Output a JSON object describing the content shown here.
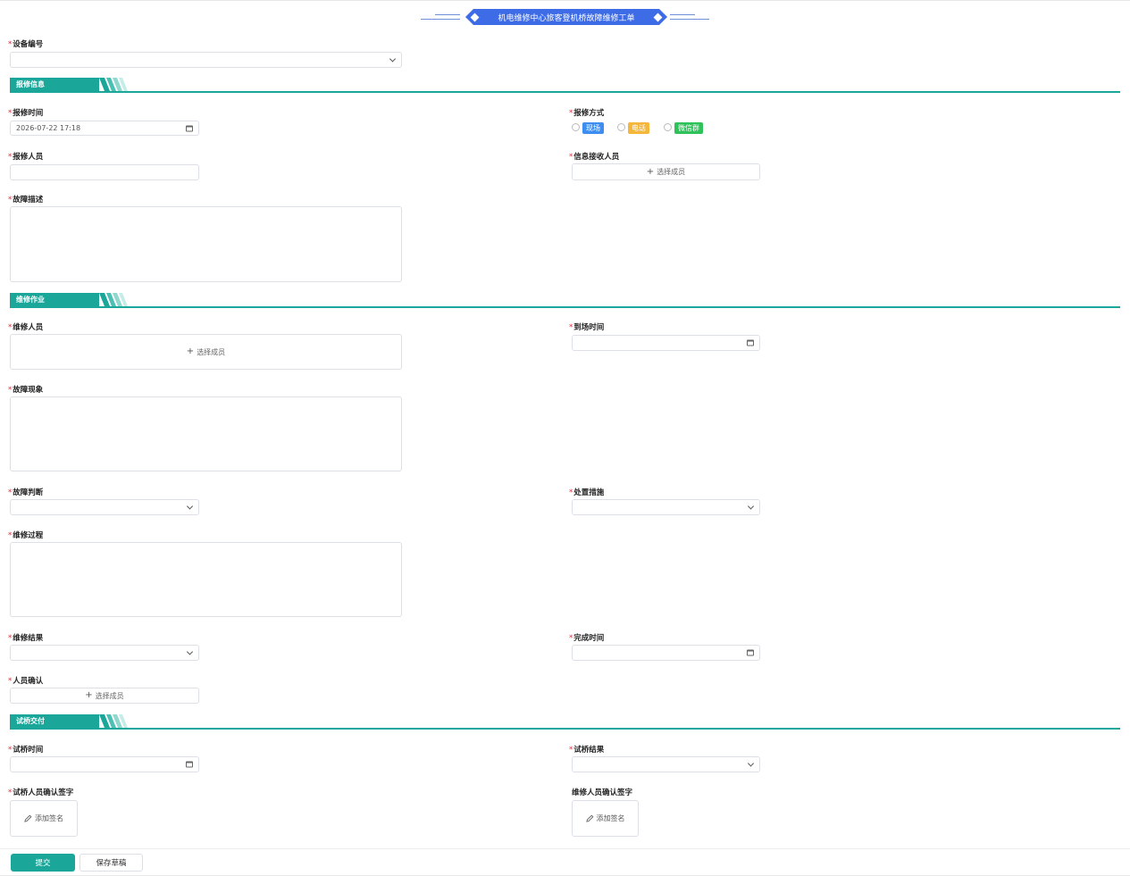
{
  "title": "机电维修中心旅客登机桥故障维修工单",
  "device_no": {
    "label": "设备编号",
    "value": ""
  },
  "sections": {
    "report": "报修信息",
    "repair": "维修作业",
    "trial": "试桥交付"
  },
  "report": {
    "time_label": "报修时间",
    "time_value": "2026-07-22 17:18",
    "method_label": "报修方式",
    "methods": [
      {
        "label": "现场",
        "color": "#3d8ef0"
      },
      {
        "label": "电话",
        "color": "#f5b73b"
      },
      {
        "label": "微信群",
        "color": "#2fc25b"
      }
    ],
    "reporter_label": "报修人员",
    "receiver_label": "信息接收人员",
    "select_member": "选择成员",
    "fault_desc_label": "故障描述"
  },
  "repair": {
    "staff_label": "维修人员",
    "select_member": "选择成员",
    "arrive_label": "到场时间",
    "phenomenon_label": "故障现象",
    "judgement_label": "故障判断",
    "measure_label": "处置措施",
    "process_label": "维修过程",
    "result_label": "维修结果",
    "finish_label": "完成时间",
    "confirm_label": "人员确认",
    "confirm_select": "选择成员"
  },
  "trial": {
    "time_label": "试桥时间",
    "result_label": "试桥结果",
    "trial_sign_label": "试桥人员确认签字",
    "repair_sign_label": "维修人员确认签字",
    "add_sign": "添加签名"
  },
  "footer": {
    "submit": "提交",
    "save_draft": "保存草稿"
  },
  "colors": {
    "accent": "#1aa79a",
    "banner": "#3d6ce6",
    "required": "#f5222d"
  }
}
